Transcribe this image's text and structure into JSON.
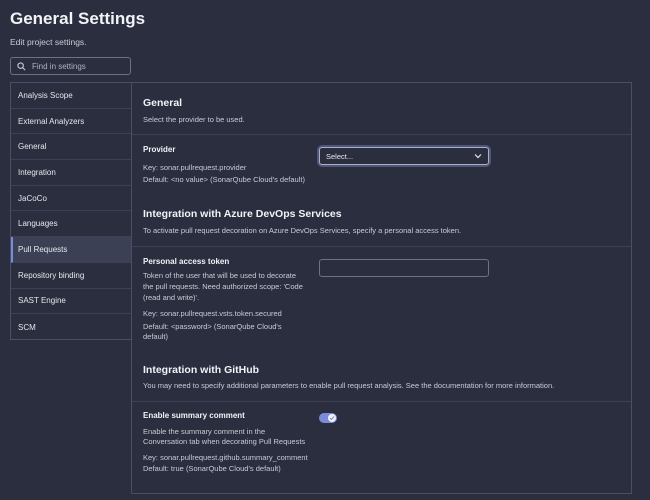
{
  "header": {
    "title": "General Settings",
    "subtitle": "Edit project settings."
  },
  "search": {
    "placeholder": "Find in settings",
    "icon": "search-icon"
  },
  "sidebar": {
    "items": [
      {
        "label": "Analysis Scope"
      },
      {
        "label": "External Analyzers"
      },
      {
        "label": "General"
      },
      {
        "label": "Integration"
      },
      {
        "label": "JaCoCo"
      },
      {
        "label": "Languages"
      },
      {
        "label": "Pull Requests",
        "active": true
      },
      {
        "label": "Repository binding"
      },
      {
        "label": "SAST Engine"
      },
      {
        "label": "SCM"
      }
    ]
  },
  "general": {
    "title": "General",
    "description": "Select the provider to be used.",
    "provider": {
      "label": "Provider",
      "key": "Key: sonar.pullrequest.provider",
      "default": "Default: <no value> (SonarQube Cloud's default)",
      "select_value": "Select..."
    }
  },
  "azure": {
    "title": "Integration with Azure DevOps Services",
    "description": "To activate pull request decoration on Azure DevOps Services, specify a personal access token.",
    "token": {
      "label": "Personal access token",
      "help_1": "Token of the user that will be used to decorate",
      "help_2": "the pull requests. Need authorized scope: 'Code",
      "help_3": "(read and write)'.",
      "key": "Key: sonar.pullrequest.vsts.token.secured",
      "default_1": "Default: <password> (SonarQube Cloud's",
      "default_2": "default)",
      "value": ""
    }
  },
  "github": {
    "title": "Integration with GitHub",
    "description": "You may need to specify additional parameters to enable pull request analysis. See the documentation for more information.",
    "summary": {
      "label": "Enable summary comment",
      "help_1": "Enable the summary comment in the",
      "help_2": "Conversation tab when decorating Pull Requests",
      "key": "Key: sonar.pullrequest.github.summary_comment",
      "default": "Default: true (SonarQube Cloud's default)",
      "enabled": true
    }
  },
  "colors": {
    "background": "#2a2e3e",
    "accent": "#7c8bd9"
  }
}
